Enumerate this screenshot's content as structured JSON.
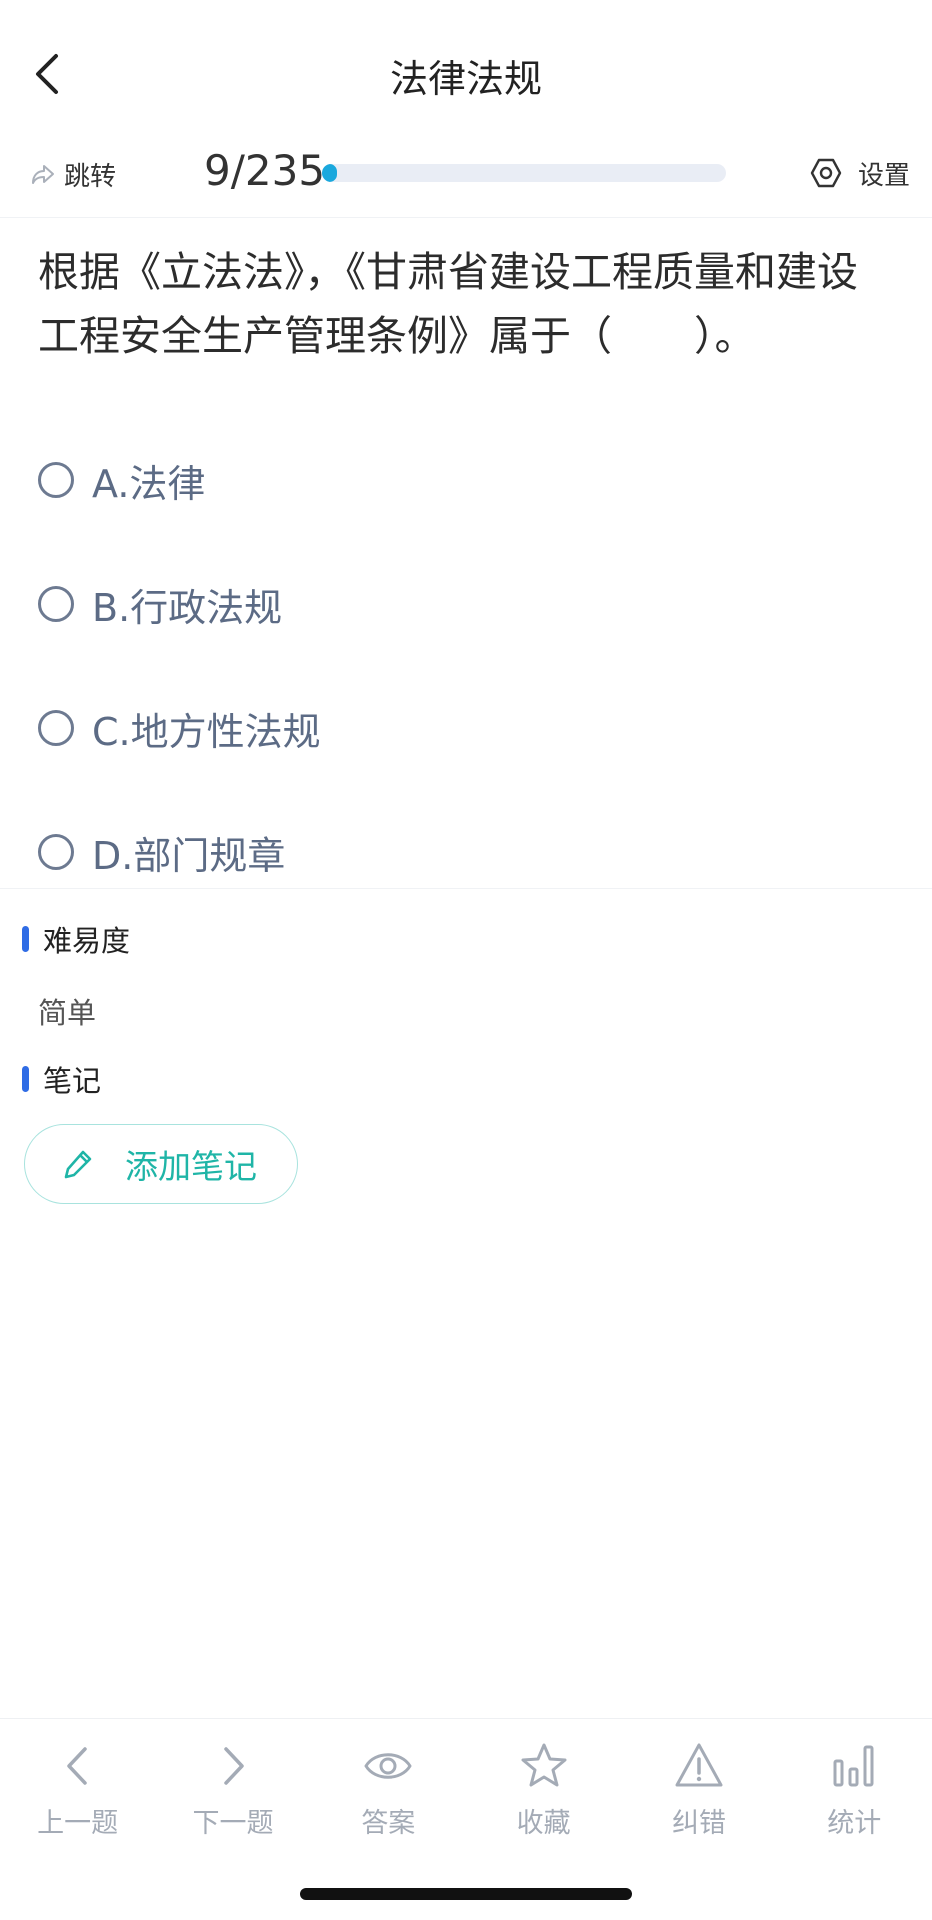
{
  "header": {
    "title": "法律法规",
    "back_icon": "chevron-left-icon"
  },
  "progress": {
    "jump_label": "跳转",
    "jump_icon": "share-forward-icon",
    "counter": "9/235",
    "current": 9,
    "total": 235,
    "fraction": 0.038,
    "settings_label": "设置",
    "settings_icon": "gear-icon",
    "accent_color": "#1aa8dd"
  },
  "question": {
    "text": "根据《立法法》，《甘肃省建设工程质量和建设工程安全生产管理条例》属于（　　）。",
    "options": [
      {
        "label": "A.法律"
      },
      {
        "label": "B.行政法规"
      },
      {
        "label": "C.地方性法规"
      },
      {
        "label": "D.部门规章"
      }
    ]
  },
  "difficulty": {
    "title": "难易度",
    "value": "简单"
  },
  "notes": {
    "title": "笔记",
    "add_label": "添加笔记",
    "add_icon": "pencil-icon"
  },
  "toolbar": {
    "items": [
      {
        "label": "上一题",
        "icon": "chevron-left-icon"
      },
      {
        "label": "下一题",
        "icon": "chevron-right-icon"
      },
      {
        "label": "答案",
        "icon": "eye-icon"
      },
      {
        "label": "收藏",
        "icon": "star-icon"
      },
      {
        "label": "纠错",
        "icon": "warning-icon"
      },
      {
        "label": "统计",
        "icon": "bar-chart-icon"
      }
    ]
  },
  "colors": {
    "section_marker": "#2f6ce5",
    "add_note": "#1fb5a7",
    "option_text": "#5c6b85",
    "toolbar_text": "#a4abb6"
  }
}
